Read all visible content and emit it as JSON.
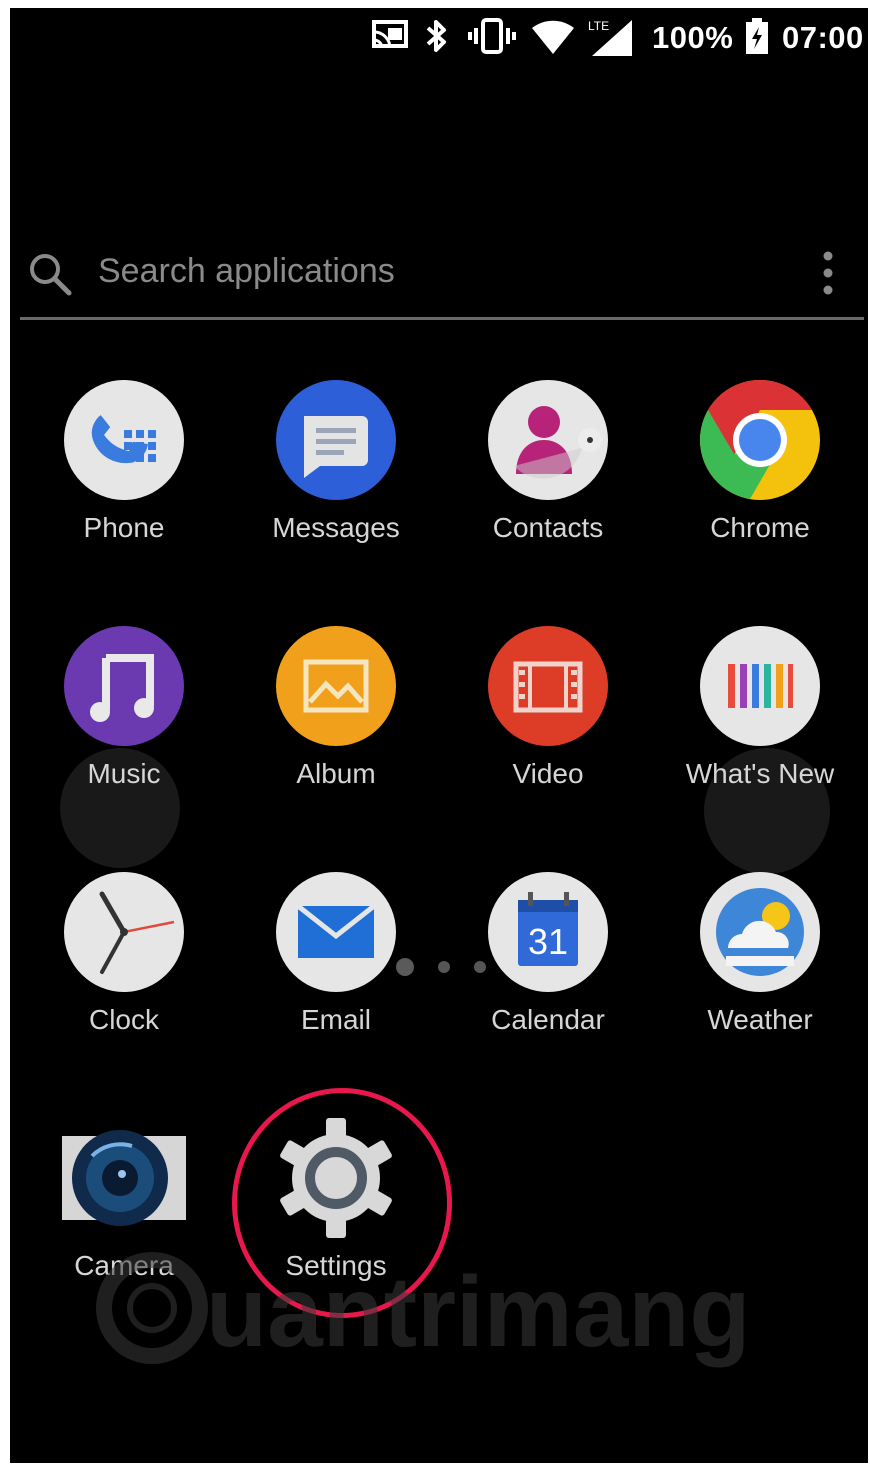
{
  "status_bar": {
    "battery": "100%",
    "time": "07:00",
    "network_badge": "LTE",
    "icons": [
      "cast-icon",
      "bluetooth-icon",
      "vibrate-icon",
      "wifi-icon",
      "signal-icon",
      "battery-charging-icon"
    ]
  },
  "search": {
    "placeholder": "Search applications",
    "icon": "search-icon",
    "menu_icon": "more-vert-icon"
  },
  "apps": [
    {
      "label": "Phone",
      "icon": "phone-icon"
    },
    {
      "label": "Messages",
      "icon": "messages-icon"
    },
    {
      "label": "Contacts",
      "icon": "contacts-icon"
    },
    {
      "label": "Chrome",
      "icon": "chrome-icon"
    },
    {
      "label": "Music",
      "icon": "music-icon"
    },
    {
      "label": "Album",
      "icon": "album-icon"
    },
    {
      "label": "Video",
      "icon": "video-icon"
    },
    {
      "label": "What's New",
      "icon": "whats-new-icon"
    },
    {
      "label": "Clock",
      "icon": "clock-icon"
    },
    {
      "label": "Email",
      "icon": "email-icon"
    },
    {
      "label": "Calendar",
      "icon": "calendar-icon",
      "calendar_day": "31"
    },
    {
      "label": "Weather",
      "icon": "weather-icon"
    },
    {
      "label": "Camera",
      "icon": "camera-icon"
    },
    {
      "label": "Settings",
      "icon": "settings-icon",
      "highlighted": true
    }
  ],
  "watermark": {
    "text": "uantrimang"
  },
  "colors": {
    "highlight_ring": "#e8174c",
    "background": "#000000",
    "label": "#d6d6d6"
  }
}
